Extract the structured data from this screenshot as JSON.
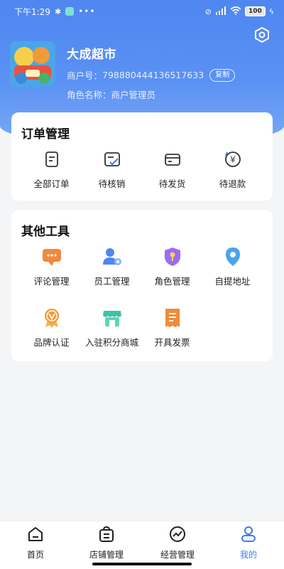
{
  "status": {
    "time": "下午1:29",
    "battery": "100"
  },
  "profile": {
    "store_name": "大成超市",
    "merchant_label": "商户号：",
    "merchant_no": "798880444136517633",
    "copy_label": "复制",
    "role_label": "角色名称：",
    "role_value": "商户管理员"
  },
  "orders": {
    "title": "订单管理",
    "items": [
      {
        "label": "全部订单",
        "icon": "document-icon"
      },
      {
        "label": "待核销",
        "icon": "checklist-icon"
      },
      {
        "label": "待发货",
        "icon": "box-icon"
      },
      {
        "label": "待退款",
        "icon": "refund-icon"
      }
    ]
  },
  "tools": {
    "title": "其他工具",
    "items": [
      {
        "label": "评论管理",
        "icon": "comment-icon"
      },
      {
        "label": "员工管理",
        "icon": "staff-icon"
      },
      {
        "label": "角色管理",
        "icon": "role-shield-icon"
      },
      {
        "label": "自提地址",
        "icon": "location-pin-icon"
      },
      {
        "label": "品牌认证",
        "icon": "brand-medal-icon"
      },
      {
        "label": "入驻积分商城",
        "icon": "points-store-icon"
      },
      {
        "label": "开具发票",
        "icon": "invoice-icon"
      }
    ]
  },
  "tabbar": {
    "items": [
      {
        "label": "首页",
        "icon": "home-icon"
      },
      {
        "label": "店铺管理",
        "icon": "shop-icon"
      },
      {
        "label": "经营管理",
        "icon": "chart-icon"
      },
      {
        "label": "我的",
        "icon": "profile-icon"
      }
    ],
    "active_index": 3
  },
  "colors": {
    "brand_blue": "#4f86f0",
    "active_tab": "#3b7cf0",
    "orange": "#f08a3c",
    "teal": "#3cc4a4",
    "purple": "#9b6cf2"
  }
}
